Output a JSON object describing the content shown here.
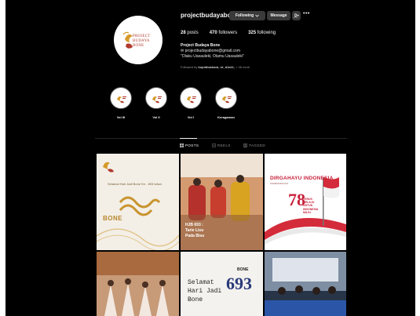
{
  "colors": {
    "background": "#000000",
    "button": "#3a3a3a",
    "text": "#f5f5f5",
    "muted": "#8e8e8e",
    "brand_red": "#b03a2e",
    "brand_gold": "#d59a2a"
  },
  "profile": {
    "logo_lines": [
      "PROJECT",
      "BUDAYA",
      "BONE"
    ],
    "username": "projectbudayabone",
    "follow_button": "Following",
    "message_button": "Message",
    "add_icon": "add-user-icon",
    "more_icon": "more-icon",
    "stats": {
      "posts": "28",
      "posts_label": "posts",
      "followers": "470",
      "followers_label": "followers",
      "following": "325",
      "following_label": "following"
    },
    "full_name": "Project Budaya Bone",
    "email": "projectbudayabone@gmail.com",
    "tagline": "\"Olaku Uasauleki, Olamu Uasauleki\"",
    "followed_by_prefix": "Followed by",
    "followed_by_names": "kopidbaskara, rd_d1a11,",
    "followed_by_more": "+ 46 more"
  },
  "highlights": [
    {
      "label": "Vol III"
    },
    {
      "label": "Vol II"
    },
    {
      "label": "Vol I"
    },
    {
      "label": "Keragaman"
    }
  ],
  "tabs": [
    {
      "label": "POSTS",
      "icon": "grid-icon",
      "active": true
    },
    {
      "label": "REELS",
      "icon": "reels-icon",
      "active": false
    },
    {
      "label": "TAGGED",
      "icon": "tagged-icon",
      "active": false
    }
  ],
  "posts": {
    "p1": {
      "heading": "Selamat Hari Jadi Bone Ke - 693 tahun",
      "title": "BONE"
    },
    "p2": {
      "line1": "HJB 693 :",
      "line2": "Tarie Lisu",
      "line3": "Pada Bisu"
    },
    "p3": {
      "title": "DIRGAHAYU INDONESIA",
      "subtitle": "KEMERDEKAAN",
      "number": "78",
      "motto1": "TERUS",
      "motto2": "MELAJU",
      "motto3": "UNTUK",
      "motto4": "INDONESIA",
      "motto5": "MAJU"
    },
    "p5": {
      "line1": "Selamat",
      "line2": "Hari Jadi",
      "line3": "Bone",
      "bone_label": "BONE",
      "number": "693"
    }
  }
}
